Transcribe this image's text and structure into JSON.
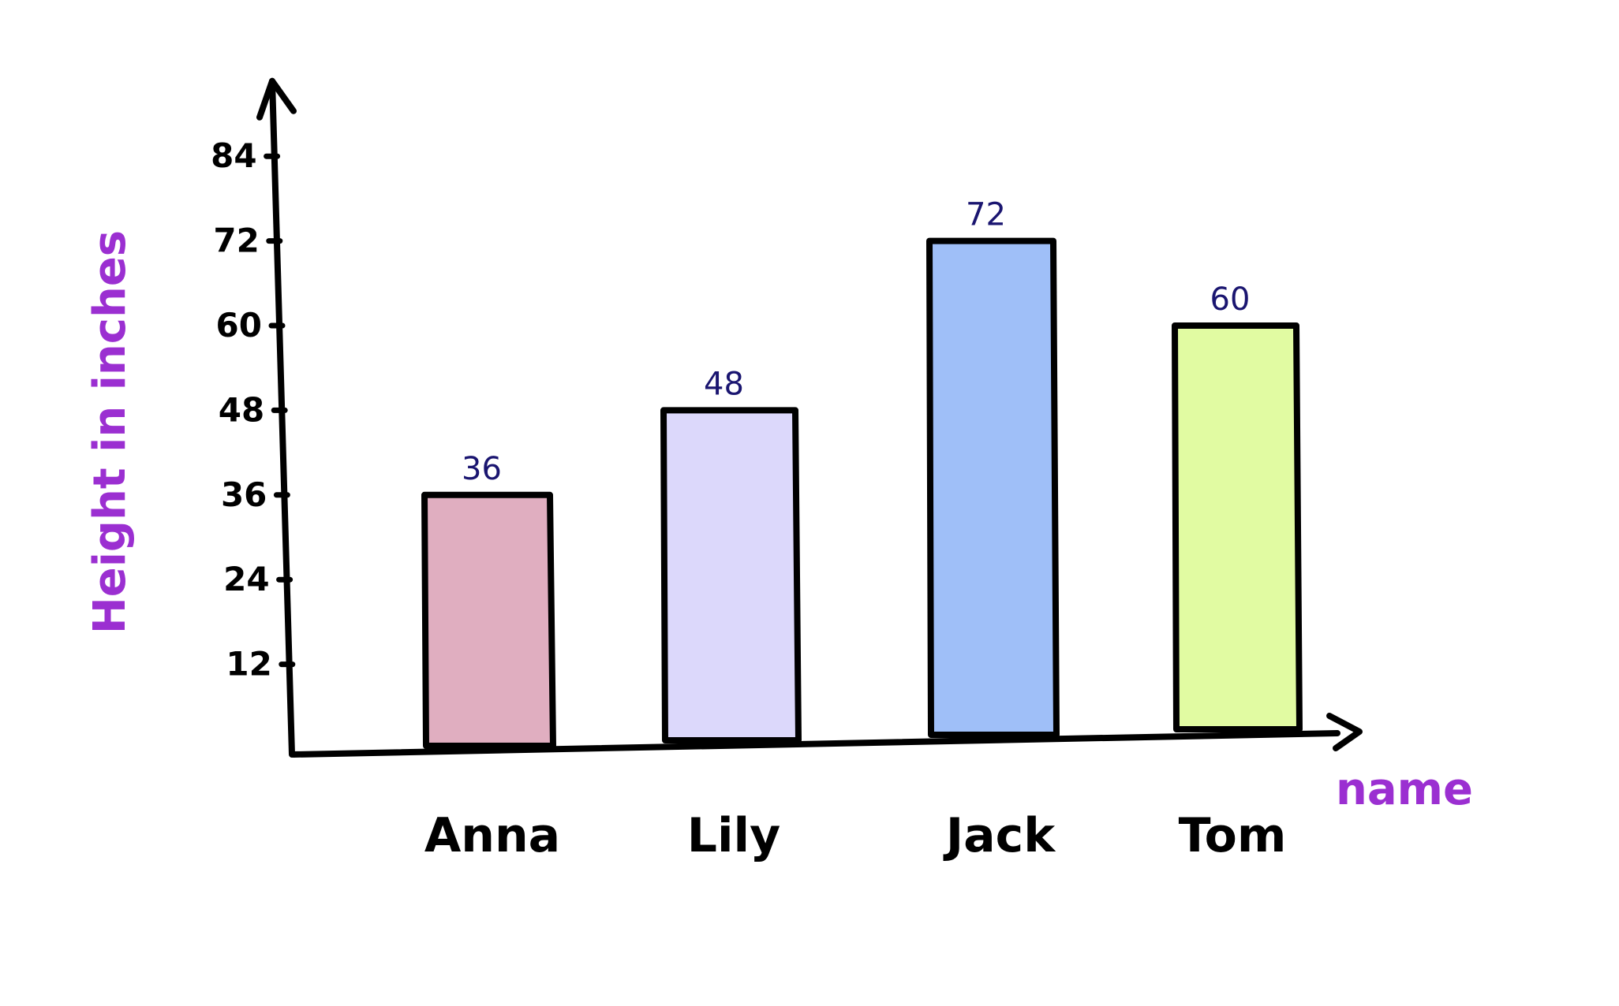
{
  "colors": {
    "ink": "#000000",
    "data_label": "#1a1570",
    "axis_title": "#9b2fd1",
    "bar_anna": "#e0aec0",
    "bar_lily": "#dcd8fb",
    "bar_jack": "#9fbff8",
    "bar_tom": "#e1fba2"
  },
  "chart_data": {
    "type": "bar",
    "categories": [
      "Anna",
      "Lily",
      "Jack",
      "Tom"
    ],
    "values": [
      36,
      48,
      72,
      60
    ],
    "data_labels": [
      "36",
      "48",
      "72",
      "60"
    ],
    "bar_colors": [
      "#e0aec0",
      "#dcd8fb",
      "#9fbff8",
      "#e1fba2"
    ],
    "xlabel": "name",
    "ylabel": "Height in inches",
    "yticks": [
      12,
      24,
      36,
      48,
      60,
      72,
      84
    ],
    "ytick_labels": [
      "12",
      "24",
      "36",
      "48",
      "60",
      "72",
      "84"
    ],
    "ylim": [
      0,
      96
    ],
    "grid": false,
    "legend": "none",
    "style": "hand-drawn"
  }
}
